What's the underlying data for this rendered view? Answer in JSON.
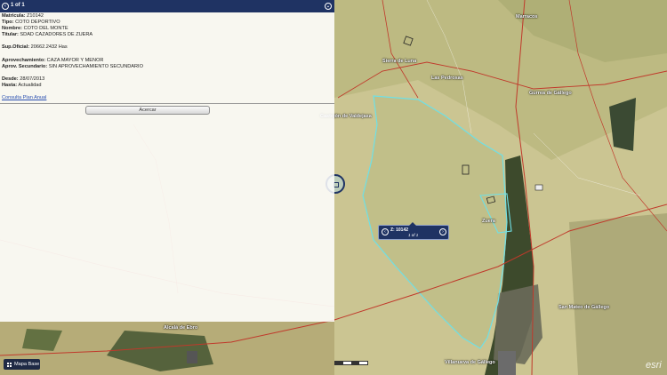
{
  "header": {
    "counter": "1 of 1"
  },
  "attributes": [
    {
      "label": "Matricula:",
      "value": "Z10142"
    },
    {
      "label": "Tipo:",
      "value": "COTO DEPORTIVO"
    },
    {
      "label": "Nombre:",
      "value": "COTO DEL MONTE"
    },
    {
      "label": "Titular:",
      "value": "SDAD CAZADORES DE ZUERA"
    },
    {
      "label": "Sup.Oficial:",
      "value": "20662.2432 Has"
    },
    {
      "label": "Aprovechamiento:",
      "value": "CAZA MAYOR Y MENOR"
    },
    {
      "label": "Aprov. Secundario:",
      "value": "SIN APROVECHAMIENTO SECUNDARIO"
    },
    {
      "label": "Desde:",
      "value": "28/07/2013"
    },
    {
      "label": "Hasta:",
      "value": "Actualidad"
    }
  ],
  "plan_link": "Consulta Plan Anual",
  "zoom_button": "Acercar",
  "popup": {
    "title": "Z: 10142",
    "counter": "1 of 1"
  },
  "basemap_button": "Mapa Base",
  "attribution": "esri",
  "map_labels": {
    "marracos": "Marracos",
    "sierra_luna": "Sierra de Luna",
    "las_pedrosas": "Las Pedrosas",
    "castejon": "Castejón de Valdejasa",
    "gurrea": "Gurrea de Gállego",
    "zuera": "Zuera",
    "san_mateo": "San Mateo de Gállego",
    "alcala": "Alcalá de Ebro",
    "villanueva": "Villanueva de Gállego"
  },
  "colors": {
    "header_bg": "#1f3363",
    "boundary": "#6fe0e6",
    "road": "#c0392b"
  }
}
